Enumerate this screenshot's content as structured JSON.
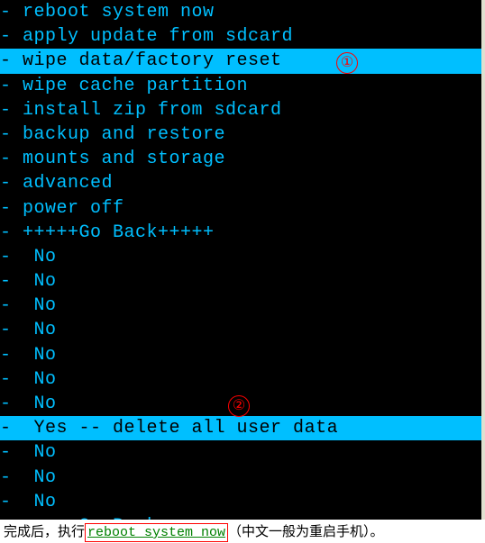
{
  "menu": [
    {
      "prefix": "- ",
      "label": "reboot system now",
      "highlighted": false
    },
    {
      "prefix": "- ",
      "label": "apply update from sdcard",
      "highlighted": false
    },
    {
      "prefix": "- ",
      "label": "wipe data/factory reset",
      "highlighted": true
    },
    {
      "prefix": "- ",
      "label": "wipe cache partition",
      "highlighted": false
    },
    {
      "prefix": "- ",
      "label": "install zip from sdcard",
      "highlighted": false
    },
    {
      "prefix": "- ",
      "label": "backup and restore",
      "highlighted": false
    },
    {
      "prefix": "- ",
      "label": "mounts and storage",
      "highlighted": false
    },
    {
      "prefix": "- ",
      "label": "advanced",
      "highlighted": false
    },
    {
      "prefix": "- ",
      "label": "power off",
      "highlighted": false
    },
    {
      "prefix": "- ",
      "label": "+++++Go Back+++++",
      "highlighted": false
    },
    {
      "prefix": "-  ",
      "label": "No",
      "highlighted": false
    },
    {
      "prefix": "-  ",
      "label": "No",
      "highlighted": false
    },
    {
      "prefix": "-  ",
      "label": "No",
      "highlighted": false
    },
    {
      "prefix": "-  ",
      "label": "No",
      "highlighted": false
    },
    {
      "prefix": "-  ",
      "label": "No",
      "highlighted": false
    },
    {
      "prefix": "-  ",
      "label": "No",
      "highlighted": false
    },
    {
      "prefix": "-  ",
      "label": "No",
      "highlighted": false
    },
    {
      "prefix": "-  ",
      "label": "Yes -- delete all user data",
      "highlighted": true
    },
    {
      "prefix": "-  ",
      "label": "No",
      "highlighted": false
    },
    {
      "prefix": "-  ",
      "label": "No",
      "highlighted": false
    },
    {
      "prefix": "-  ",
      "label": "No",
      "highlighted": false
    },
    {
      "prefix": "- ",
      "label": "+++++Go Back+++++",
      "highlighted": false
    }
  ],
  "annotations": {
    "one": "①",
    "two": "②"
  },
  "caption": {
    "pre": "完成后，执行",
    "boxed": "reboot system now",
    "post": "（中文一般为重启手机）。"
  }
}
